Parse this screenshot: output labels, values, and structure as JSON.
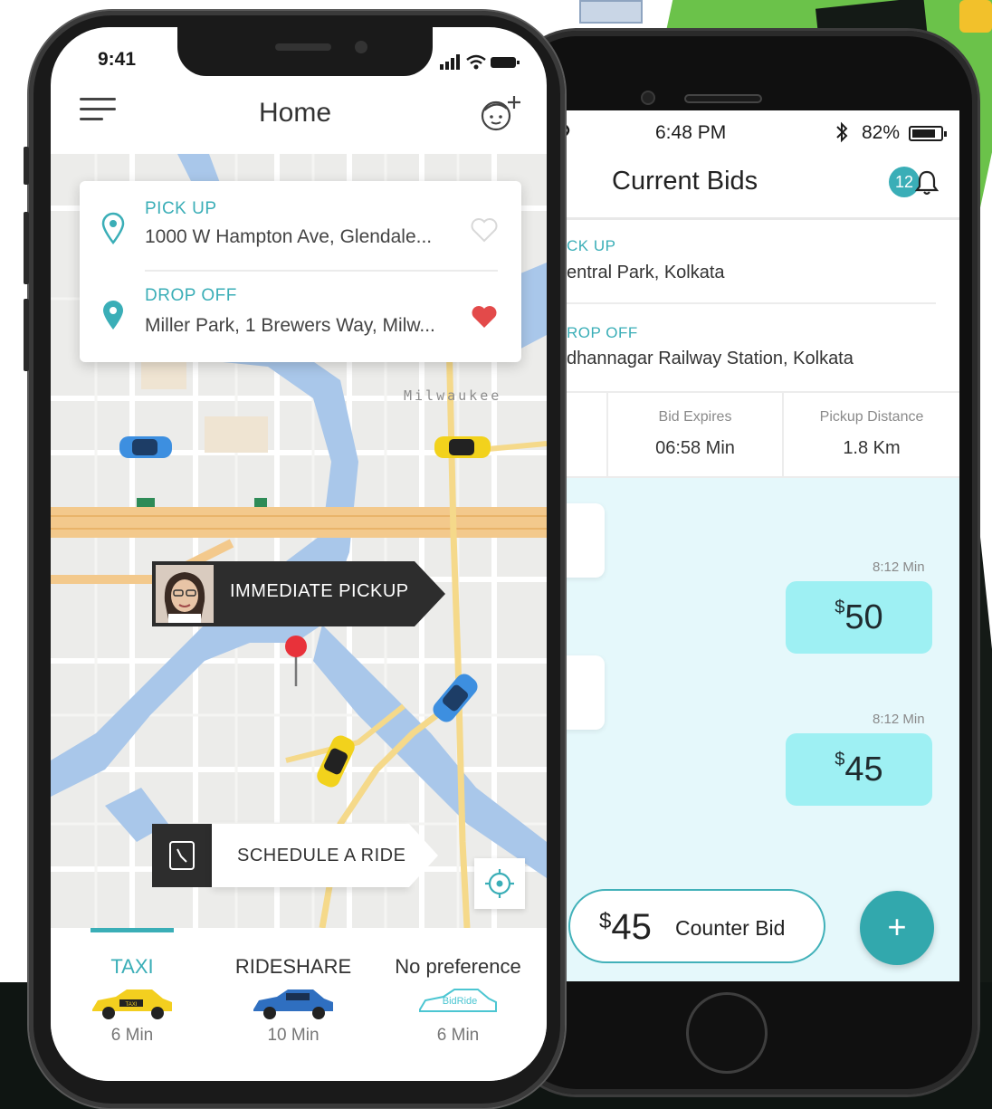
{
  "left_phone": {
    "status_time": "9:41",
    "header_title": "Home",
    "pickup": {
      "label": "PICK UP",
      "address": "1000 W Hampton Ave, Glendale..."
    },
    "dropoff": {
      "label": "DROP OFF",
      "address": "Miller Park, 1 Brewers Way, Milw..."
    },
    "map_city_label": "Milwaukee",
    "immediate_pickup_label": "IMMEDIATE PICKUP",
    "schedule_label": "SCHEDULE A RIDE",
    "tabs": [
      {
        "label": "TAXI",
        "car_text": "TAXI",
        "eta": "6 Min"
      },
      {
        "label": "RIDESHARE",
        "eta": "10 Min"
      },
      {
        "label": "No preference",
        "car_text": "BidRide",
        "eta": "6 Min"
      }
    ]
  },
  "right_phone": {
    "status_time": "6:48 PM",
    "battery": "82%",
    "battery_level": 0.82,
    "title": "Current Bids",
    "notification_count": "12",
    "pickup_label": "CK UP",
    "pickup_value": "entral Park, Kolkata",
    "dropoff_label": "ROP OFF",
    "dropoff_value": "dhannagar Railway Station, Kolkata",
    "bid_expires_label": "Bid Expires",
    "bid_expires_value": "06:58 Min",
    "pickup_distance_label": "Pickup Distance",
    "pickup_distance_value": "1.8 Km",
    "bids": [
      {
        "time": "8:12 Min",
        "currency": "$",
        "amount": "50"
      },
      {
        "time": "8:12 Min",
        "currency": "$",
        "amount": "45"
      }
    ],
    "counter_bid": {
      "currency": "$",
      "amount": "45",
      "label": "Counter Bid"
    },
    "fab_label": "+"
  },
  "colors": {
    "accent": "#3aaeb7",
    "bid_bubble": "#9ef0f3",
    "bids_bg": "#e5f8fb",
    "heart": "#e34a4a"
  }
}
